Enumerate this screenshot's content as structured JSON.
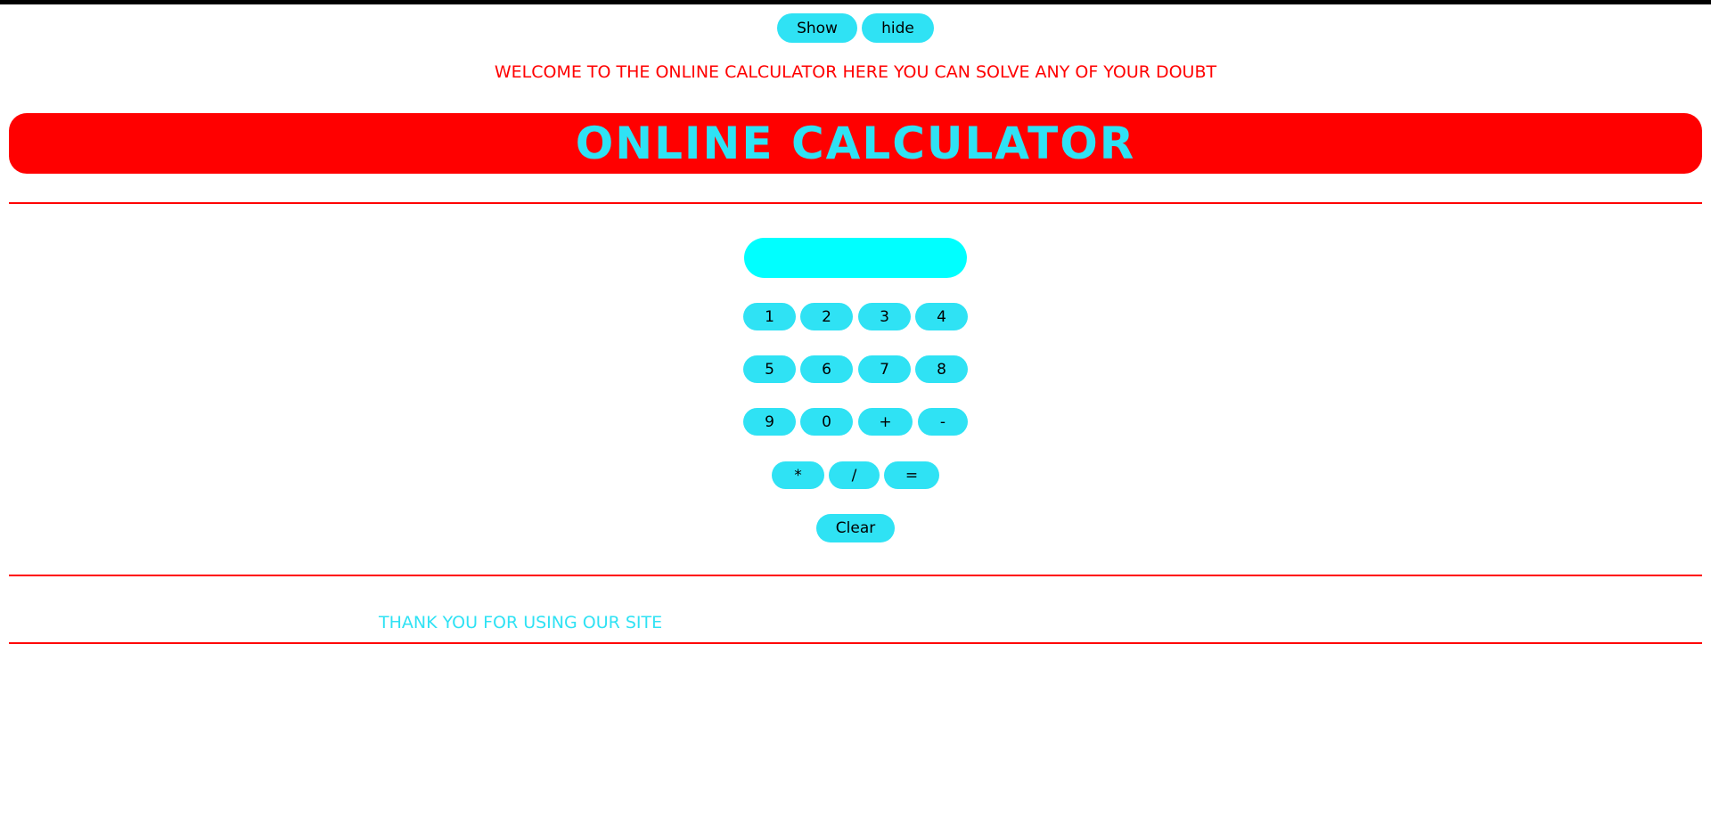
{
  "controls": {
    "show_label": "Show",
    "hide_label": "hide"
  },
  "welcome_text": "WELCOME TO THE ONLINE CALCULATOR HERE YOU CAN SOLVE ANY OF YOUR DOUBT",
  "banner_title": "ONLINE CALCULATOR",
  "display": {
    "value": "",
    "placeholder": ""
  },
  "keypad": {
    "row1": [
      "1",
      "2",
      "3",
      "4"
    ],
    "row2": [
      "5",
      "6",
      "7",
      "8"
    ],
    "row3": [
      "9",
      "0",
      "+",
      "-"
    ],
    "row4": [
      "*",
      "/",
      "="
    ],
    "clear_label": "Clear"
  },
  "footer_text": "THANK YOU FOR USING OUR SITE",
  "colors": {
    "accent_cyan": "#2fe2f4",
    "display_cyan": "#00ffff",
    "brand_red": "#ff0000"
  }
}
